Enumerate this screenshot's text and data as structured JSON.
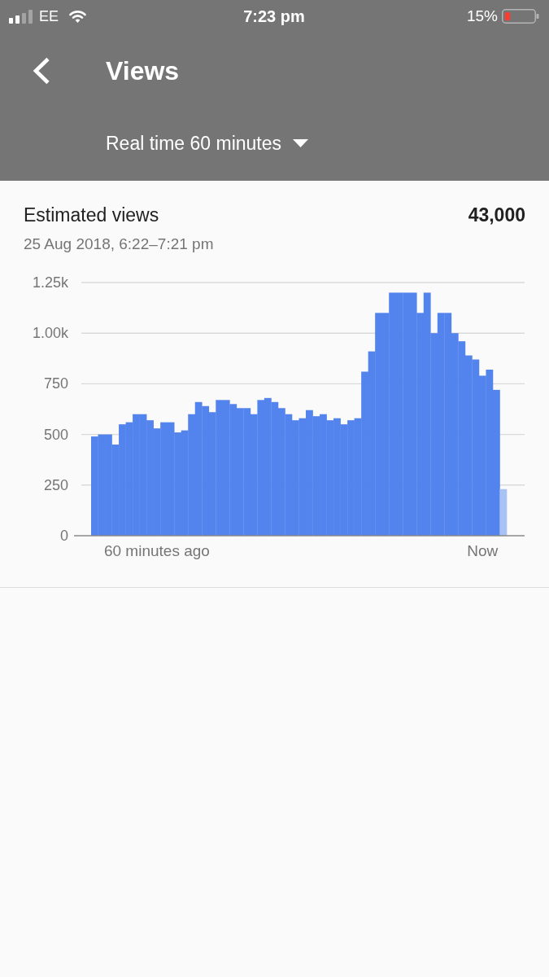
{
  "status_bar": {
    "carrier": "EE",
    "time": "7:23 pm",
    "battery": "15%"
  },
  "header": {
    "title": "Views",
    "range": "Real time 60 minutes"
  },
  "card": {
    "title": "Estimated views",
    "total": "43,000",
    "date_range": "25 Aug 2018, 6:22–7:21 pm",
    "chart_data": {
      "type": "bar",
      "categories": [
        null,
        null,
        null,
        null,
        null,
        null,
        null,
        null,
        null,
        "60 minutes ago",
        null,
        null,
        null,
        null,
        null,
        null,
        null,
        null,
        null,
        null,
        null,
        null,
        null,
        null,
        null,
        null,
        null,
        null,
        null,
        null,
        null,
        null,
        null,
        null,
        null,
        null,
        null,
        null,
        null,
        null,
        null,
        null,
        null,
        null,
        null,
        null,
        null,
        null,
        null,
        null,
        null,
        null,
        null,
        null,
        null,
        null,
        "Now",
        null,
        null,
        null
      ],
      "ylim": [
        0,
        1250
      ],
      "yticks": [
        0,
        250,
        500,
        750,
        {
          "value": 1000,
          "label": "1.00k"
        },
        {
          "value": 1250,
          "label": "1.25k"
        }
      ],
      "grid": true,
      "series": [
        {
          "color": "#5383ec",
          "values": [
            490,
            500,
            500,
            450,
            550,
            560,
            600,
            600,
            570,
            530,
            560,
            560,
            510,
            520,
            600,
            660,
            640,
            610,
            670,
            670,
            650,
            630,
            630,
            600,
            670,
            680,
            660,
            630,
            600,
            570,
            580,
            620,
            590,
            600,
            570,
            580,
            550,
            570,
            580,
            810,
            910,
            1100,
            1100,
            1200,
            1200,
            1200,
            1200,
            1100,
            1200,
            1000,
            1100,
            1100,
            1000,
            960,
            890,
            870,
            790,
            820,
            720,
            null
          ]
        },
        {
          "color": "#a9c2f4",
          "values": [
            null,
            null,
            null,
            null,
            null,
            null,
            null,
            null,
            null,
            null,
            null,
            null,
            null,
            null,
            null,
            null,
            null,
            null,
            null,
            null,
            null,
            null,
            null,
            null,
            null,
            null,
            null,
            null,
            null,
            null,
            null,
            null,
            null,
            null,
            null,
            null,
            null,
            null,
            null,
            null,
            null,
            null,
            null,
            null,
            null,
            null,
            null,
            null,
            null,
            null,
            null,
            null,
            null,
            null,
            null,
            null,
            null,
            null,
            null,
            230
          ]
        }
      ]
    }
  }
}
